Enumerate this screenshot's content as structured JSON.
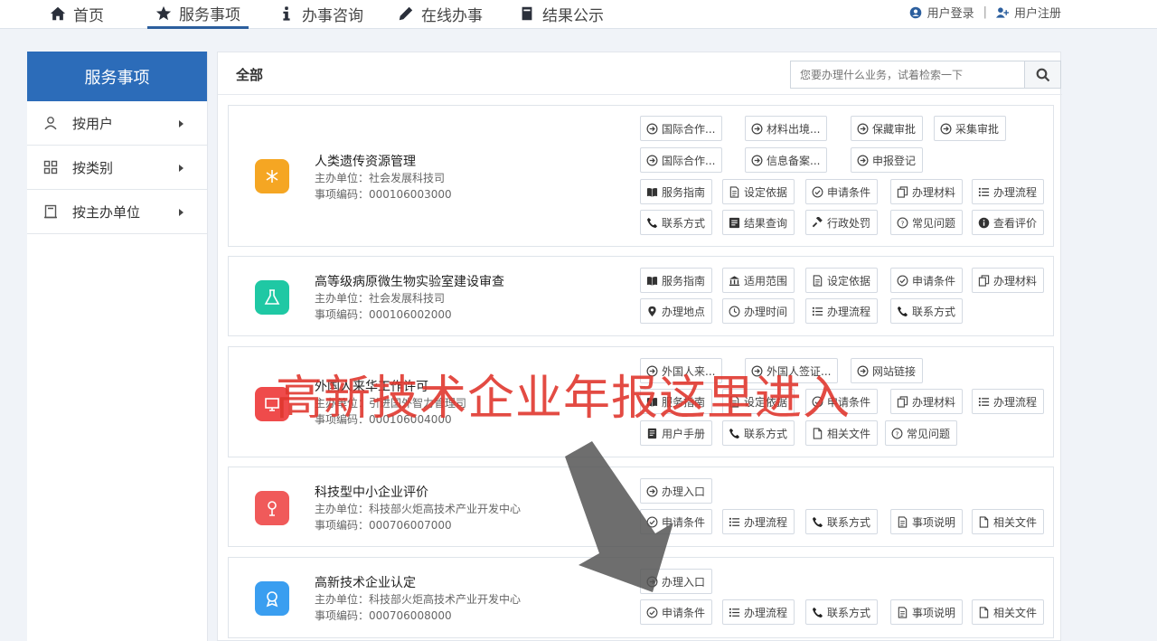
{
  "nav": {
    "items": [
      {
        "label": "首页",
        "icon": "home-icon"
      },
      {
        "label": "服务事项",
        "icon": "star-icon",
        "active": true
      },
      {
        "label": "办事咨询",
        "icon": "info-icon"
      },
      {
        "label": "在线办事",
        "icon": "pencil-icon"
      },
      {
        "label": "结果公示",
        "icon": "book-icon"
      }
    ],
    "login": "用户登录",
    "separator": "|",
    "register": "用户注册"
  },
  "sidebar": {
    "title": "服务事项",
    "items": [
      {
        "label": "按用户",
        "icon": "user-icon"
      },
      {
        "label": "按类别",
        "icon": "grid-icon"
      },
      {
        "label": "按主办单位",
        "icon": "building-icon"
      }
    ]
  },
  "main": {
    "title": "全部",
    "search_placeholder": "您要办理什么业务，试着检索一下"
  },
  "cards": [
    {
      "name": "人类遗传资源管理",
      "org": "主办单位：社会发展科技司",
      "code": "事项编码：000106003000",
      "icon_color": "#f5a623",
      "buttons": [
        {
          "label": "国际合作...",
          "icon": "arrow-circle-icon"
        },
        {
          "label": "材料出境...",
          "icon": "arrow-circle-icon"
        },
        {
          "label": "保藏审批",
          "icon": "arrow-circle-icon"
        },
        {
          "label": "采集审批",
          "icon": "arrow-circle-icon"
        },
        {
          "label": "国际合作...",
          "icon": "arrow-circle-icon"
        },
        {
          "label": "信息备案...",
          "icon": "arrow-circle-icon"
        },
        {
          "label": "申报登记",
          "icon": "arrow-circle-icon"
        },
        {
          "label": "服务指南",
          "icon": "book-icon"
        },
        {
          "label": "设定依据",
          "icon": "document-icon"
        },
        {
          "label": "申请条件",
          "icon": "check-circle-icon"
        },
        {
          "label": "办理材料",
          "icon": "copy-icon"
        },
        {
          "label": "办理流程",
          "icon": "list-icon"
        },
        {
          "label": "联系方式",
          "icon": "phone-icon"
        },
        {
          "label": "结果查询",
          "icon": "result-icon"
        },
        {
          "label": "行政处罚",
          "icon": "gavel-icon"
        },
        {
          "label": "常见问题",
          "icon": "question-icon"
        },
        {
          "label": "查看评价",
          "icon": "info-circle-icon"
        }
      ]
    },
    {
      "name": "高等级病原微生物实验室建设审查",
      "org": "主办单位：社会发展科技司",
      "code": "事项编码：000106002000",
      "icon_color": "#1fc8a4",
      "buttons": [
        {
          "label": "服务指南",
          "icon": "book-icon"
        },
        {
          "label": "适用范围",
          "icon": "bank-icon"
        },
        {
          "label": "设定依据",
          "icon": "document-icon"
        },
        {
          "label": "申请条件",
          "icon": "check-circle-icon"
        },
        {
          "label": "办理材料",
          "icon": "copy-icon"
        },
        {
          "label": "办理地点",
          "icon": "location-icon"
        },
        {
          "label": "办理时间",
          "icon": "clock-icon"
        },
        {
          "label": "办理流程",
          "icon": "list-icon"
        },
        {
          "label": "联系方式",
          "icon": "phone-icon"
        }
      ]
    },
    {
      "name": "外国人来华工作许可",
      "org": "主办单位：引进国外智力管理司",
      "code": "事项编码：000106004000",
      "icon_color": "#ef4b4b",
      "buttons": [
        {
          "label": "外国人来...",
          "icon": "arrow-circle-icon"
        },
        {
          "label": "外国人签证...",
          "icon": "arrow-circle-icon"
        },
        {
          "label": "网站链接",
          "icon": "arrow-circle-icon"
        },
        {
          "label": "服务指南",
          "icon": "book-icon"
        },
        {
          "label": "设定依据",
          "icon": "document-icon"
        },
        {
          "label": "申请条件",
          "icon": "check-circle-icon"
        },
        {
          "label": "办理材料",
          "icon": "copy-icon"
        },
        {
          "label": "办理流程",
          "icon": "list-icon"
        },
        {
          "label": "用户手册",
          "icon": "manual-icon"
        },
        {
          "label": "联系方式",
          "icon": "phone-icon"
        },
        {
          "label": "相关文件",
          "icon": "file-icon"
        },
        {
          "label": "常见问题",
          "icon": "question-icon"
        }
      ]
    },
    {
      "name": "科技型中小企业评价",
      "org": "主办单位：科技部火炬高技术产业开发中心",
      "code": "事项编码：000706007000",
      "icon_color": "#f05a5a",
      "buttons": [
        {
          "label": "办理入口",
          "icon": "arrow-circle-icon"
        },
        {
          "label": "申请条件",
          "icon": "check-circle-icon"
        },
        {
          "label": "办理流程",
          "icon": "list-icon"
        },
        {
          "label": "联系方式",
          "icon": "phone-icon"
        },
        {
          "label": "事项说明",
          "icon": "document-icon"
        },
        {
          "label": "相关文件",
          "icon": "file-icon"
        }
      ]
    },
    {
      "name": "高新技术企业认定",
      "org": "主办单位：科技部火炬高技术产业开发中心",
      "code": "事项编码：000706008000",
      "icon_color": "#3a9ef0",
      "buttons": [
        {
          "label": "办理入口",
          "icon": "arrow-circle-icon"
        },
        {
          "label": "申请条件",
          "icon": "check-circle-icon"
        },
        {
          "label": "办理流程",
          "icon": "list-icon"
        },
        {
          "label": "联系方式",
          "icon": "phone-icon"
        },
        {
          "label": "事项说明",
          "icon": "document-icon"
        },
        {
          "label": "相关文件",
          "icon": "file-icon"
        }
      ]
    }
  ],
  "overlay": {
    "caption": "高新技术企业年报这里进入",
    "caption_color": "#e0382f"
  },
  "colors": {
    "brand": "#2c6cb9"
  }
}
